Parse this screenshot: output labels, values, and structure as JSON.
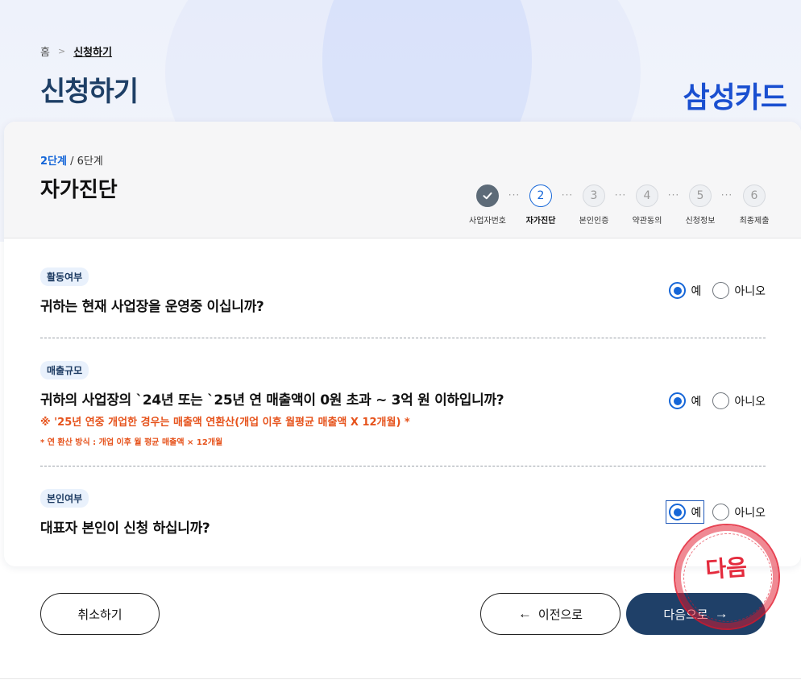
{
  "breadcrumb": {
    "home": "홈",
    "current": "신청하기"
  },
  "page_title": "신청하기",
  "brand": "삼성카드",
  "progress": {
    "current": "2단계",
    "total": " / 6단계",
    "title": "자가진단"
  },
  "steps": [
    {
      "num": "",
      "label": "사업자번호",
      "state": "done"
    },
    {
      "num": "2",
      "label": "자가진단",
      "state": "active"
    },
    {
      "num": "3",
      "label": "본인인증",
      "state": "todo"
    },
    {
      "num": "4",
      "label": "약관동의",
      "state": "todo"
    },
    {
      "num": "5",
      "label": "신청정보",
      "state": "todo"
    },
    {
      "num": "6",
      "label": "최종제출",
      "state": "todo"
    }
  ],
  "step_dots": "···",
  "questions": [
    {
      "tag": "활동여부",
      "text": "귀하는 현재 사업장을 운영중 이십니까?",
      "yes": "예",
      "no": "아니오",
      "selected": "yes"
    },
    {
      "tag": "매출규모",
      "text": "귀하의 사업장의 `24년 또는 `25년 연 매출액이 0원 초과 ~ 3억 원 이하입니까?",
      "note1": "※ '25년 연중 개업한 경우는 매출액 연환산(개업 이후 월평균 매출액 X 12개월) *",
      "note2": "* 연 환산 방식 : 개업 이후 월 평균 매출액 × 12개월",
      "yes": "예",
      "no": "아니오",
      "selected": "yes"
    },
    {
      "tag": "본인여부",
      "text": "대표자 본인이 신청 하십니까?",
      "yes": "예",
      "no": "아니오",
      "selected": "yes"
    }
  ],
  "buttons": {
    "cancel": "취소하기",
    "prev": "이전으로",
    "next": "다음으로",
    "prev_arrow": "←",
    "next_arrow": "→"
  },
  "stamp": "다음",
  "icons": {
    "check": "check-icon",
    "arrow_left": "arrow-left-icon",
    "arrow_right": "arrow-right-icon"
  },
  "colors": {
    "accent": "#1566d8",
    "title": "#1e3f66",
    "primary_button": "#1f4068",
    "warning": "#e6531c",
    "brand": "#1a4fd0"
  }
}
